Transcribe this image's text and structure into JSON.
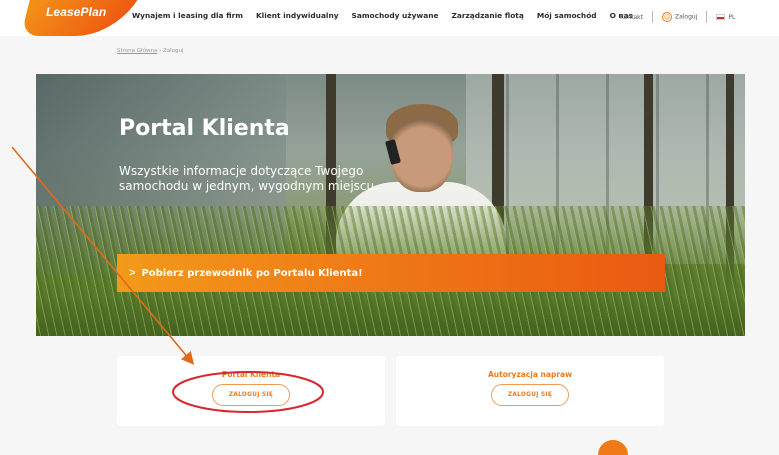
{
  "header": {
    "logo": "LeasePlan",
    "nav": [
      "Wynajem i leasing dla firm",
      "Klient indywidualny",
      "Samochody używane",
      "Zarządzanie flotą",
      "Mój samochód",
      "O nas"
    ],
    "contact": "Kontakt",
    "login": "Zaloguj",
    "language": "PL"
  },
  "breadcrumb": {
    "home": "Strona Główna",
    "separator": "›",
    "current": "Zaloguj"
  },
  "hero": {
    "title": "Portal Klienta",
    "description": "Wszystkie informacje dotyczące Twojego samochodu w jednym, wygodnym miejscu.",
    "banner_chevron": ">",
    "banner_text": "Pobierz przewodnik po Portalu Klienta!"
  },
  "cards": [
    {
      "title": "Portal Klienta",
      "button": "ZALOGUJ SIĘ"
    },
    {
      "title": "Autoryzacja napraw",
      "button": "ZALOGUJ SIĘ"
    }
  ],
  "colors": {
    "brand_orange": "#ee7a1a",
    "annotation": "#d9262e",
    "arrow": "#e06a1a"
  },
  "icons": [
    "user-icon",
    "flag-pl-icon",
    "chevron-right-icon"
  ]
}
